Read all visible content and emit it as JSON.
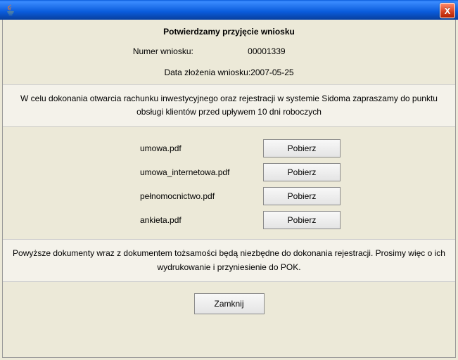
{
  "window": {
    "close_label": "X"
  },
  "title": "Potwierdzamy przyjęcie wniosku",
  "form": {
    "num_label": "Numer wniosku:",
    "num_value": "00001339",
    "date_label": "Data złożenia wniosku:",
    "date_value": "2007-05-25"
  },
  "info": "W celu dokonania otwarcia rachunku inwestycyjnego oraz rejestracji w systemie Sidoma zapraszamy do punktu obsługi klientów przed upływem 10 dni roboczych",
  "files": [
    {
      "name": "umowa.pdf",
      "btn": "Pobierz"
    },
    {
      "name": "umowa_internetowa.pdf",
      "btn": "Pobierz"
    },
    {
      "name": "pełnomocnictwo.pdf",
      "btn": "Pobierz"
    },
    {
      "name": "ankieta.pdf",
      "btn": "Pobierz"
    }
  ],
  "footer": "Powyższe dokumenty wraz z dokumentem tożsamości będą niezbędne do dokonania rejestracji. Prosimy więc o ich wydrukowanie i przyniesienie do POK.",
  "close_btn": "Zamknij"
}
